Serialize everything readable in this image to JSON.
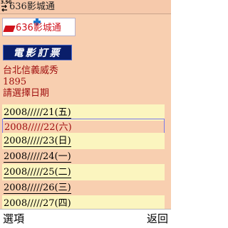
{
  "status": {
    "network": "3.5G",
    "title": "636影城通"
  },
  "logo": {
    "text": "636影城通"
  },
  "banner": {
    "text": "電影訂票"
  },
  "info": {
    "theater": "台北信義威秀",
    "time": "1895",
    "prompt": "請選擇日期"
  },
  "dates": [
    "2008/////21(五)",
    "2008/////22(六)",
    "2008/////23(日)",
    "2008/////24(一)",
    "2008/////25(二)",
    "2008/////26(三)",
    "2008/////27(四)"
  ],
  "softkeys": {
    "left": "選項",
    "right": "返回"
  }
}
